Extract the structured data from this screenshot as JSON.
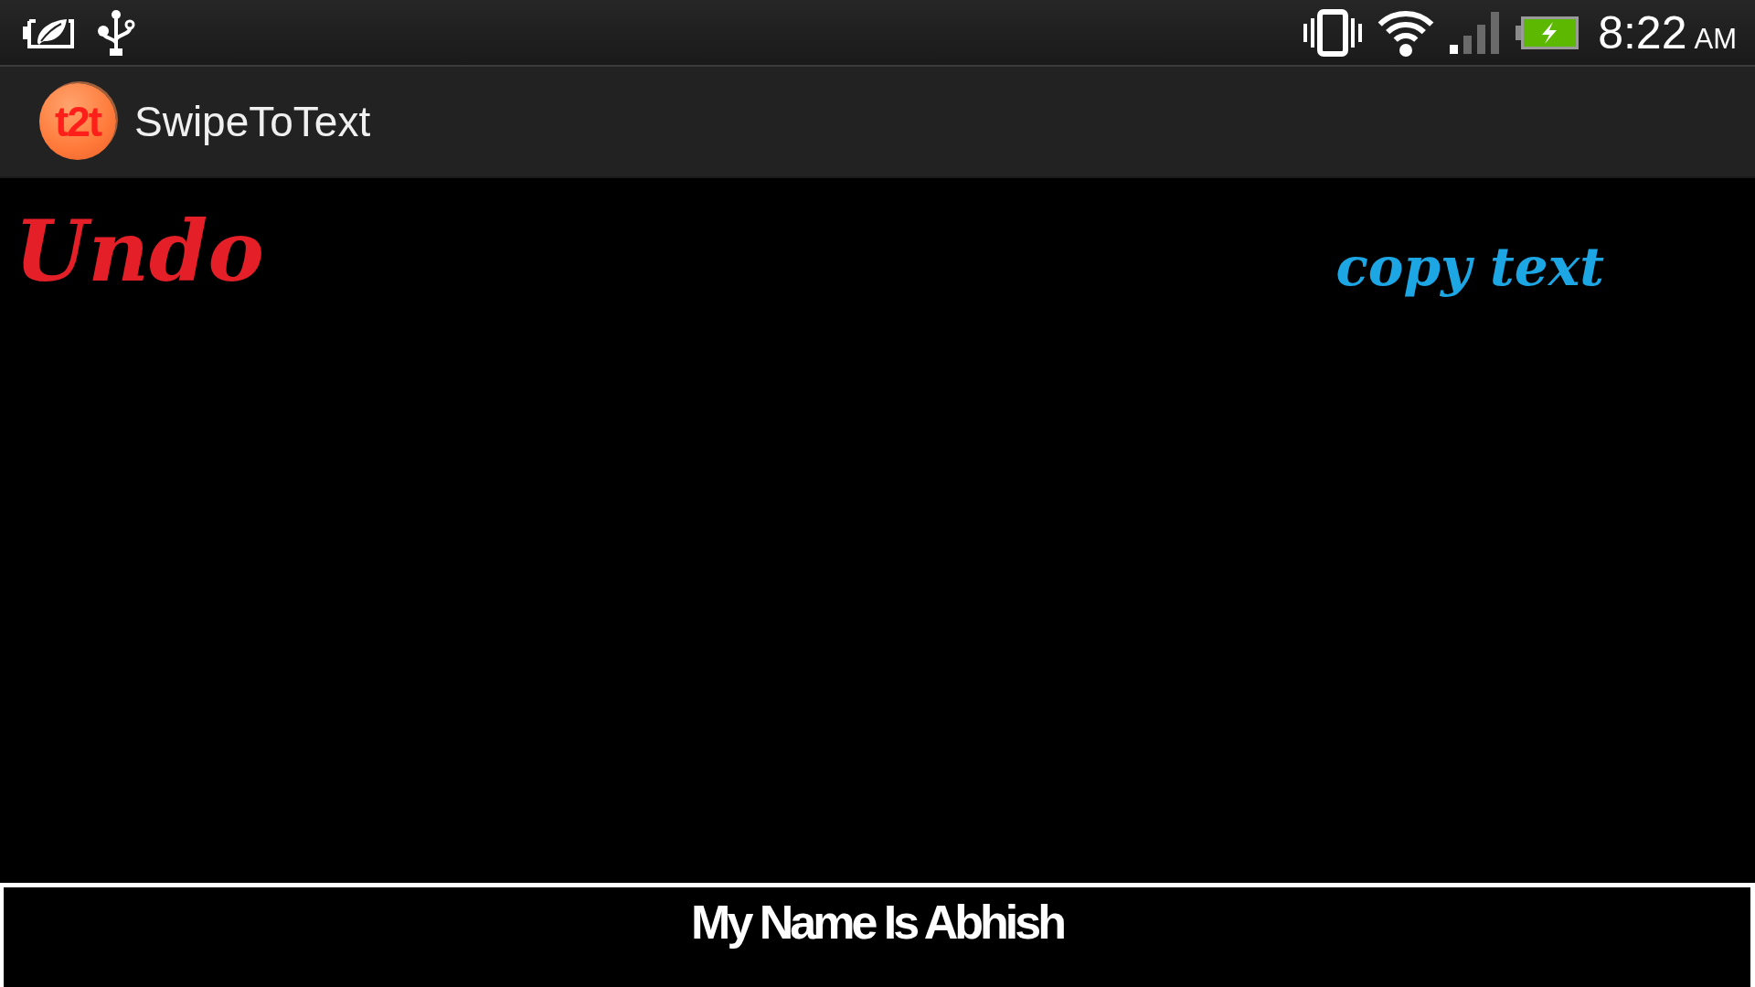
{
  "status_bar": {
    "time": "8:22",
    "period": "AM"
  },
  "action_bar": {
    "logo_text": "t2t",
    "title": "SwipeToText"
  },
  "canvas": {
    "buttons": [
      {
        "kind": "undo",
        "label": "Undo"
      },
      {
        "kind": "copy",
        "label": "copy text"
      }
    ]
  },
  "output": {
    "text": "My Name Is Abhish"
  }
}
